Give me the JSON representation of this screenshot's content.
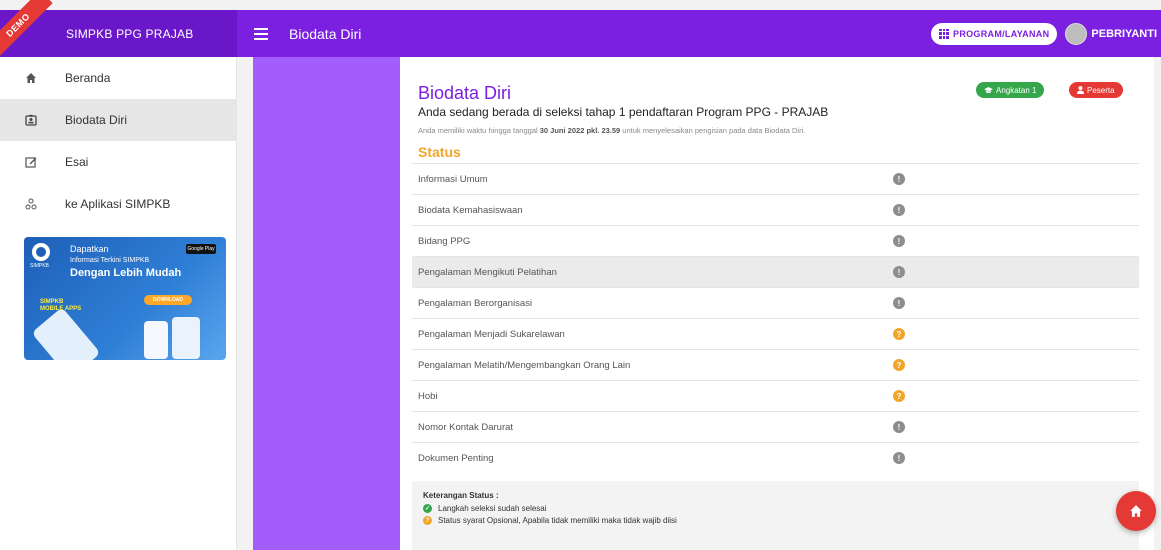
{
  "brand": {
    "ribbon": "DEMO",
    "title": "SIMPKB PPG PRAJAB"
  },
  "header": {
    "title": "Biodata Diri",
    "program_button": "PROGRAM/LAYANAN",
    "user_name": "PEBRIYANTI"
  },
  "sidebar": {
    "items": [
      {
        "label": "Beranda",
        "icon": "home-icon"
      },
      {
        "label": "Biodata Diri",
        "icon": "id-badge-icon",
        "active": true
      },
      {
        "label": "Esai",
        "icon": "edit-icon"
      },
      {
        "label": "ke Aplikasi SIMPKB",
        "icon": "apps-icon"
      }
    ],
    "banner": {
      "heading": "Dapatkan",
      "line1": "Informasi Terkini SIMPKB",
      "line2": "Dengan Lebih Mudah",
      "download": "DOWNLOAD",
      "app_label": "SIMPKB MOBILE APPS",
      "logo_text": "SIMPKB",
      "store": "Google Play"
    }
  },
  "main": {
    "title": "Biodata Diri",
    "badges": {
      "angkatan": "Angkatan 1",
      "peserta": "Peserta"
    },
    "subtitle": "Anda sedang berada di seleksi tahap 1 pendaftaran Program PPG - PRAJAB",
    "note_prefix": "Anda memiliki waktu hingga tanggal ",
    "note_deadline": "30 Juni 2022 pkl. 23.59",
    "note_suffix": " untuk menyelesaikan pengisian pada data Biodata Diri.",
    "status_heading": "Status",
    "status_rows": [
      {
        "label": "Informasi Umum",
        "status": "grey",
        "symbol": "!"
      },
      {
        "label": "Biodata Kemahasiswaan",
        "status": "grey",
        "symbol": "!"
      },
      {
        "label": "Bidang PPG",
        "status": "grey",
        "symbol": "!"
      },
      {
        "label": "Pengalaman Mengikuti Pelatihan",
        "status": "grey",
        "symbol": "!",
        "highlighted": true
      },
      {
        "label": "Pengalaman Berorganisasi",
        "status": "grey",
        "symbol": "!"
      },
      {
        "label": "Pengalaman Menjadi Sukarelawan",
        "status": "yellow",
        "symbol": "?"
      },
      {
        "label": "Pengalaman Melatih/Mengembangkan Orang Lain",
        "status": "yellow",
        "symbol": "?"
      },
      {
        "label": "Hobi",
        "status": "yellow",
        "symbol": "?"
      },
      {
        "label": "Nomor Kontak Darurat",
        "status": "grey",
        "symbol": "!"
      },
      {
        "label": "Dokumen Penting",
        "status": "grey",
        "symbol": "!"
      }
    ],
    "legend": {
      "title": "Keterangan Status :",
      "items": [
        {
          "text": "Langkah seleksi sudah selesai",
          "color": "green"
        },
        {
          "text": "Status syarat Opsional, Apabila tidak memiliki maka tidak wajib diisi",
          "color": "yellow"
        }
      ]
    }
  },
  "colors": {
    "primary": "#7b1fe0",
    "accent_column": "#a45dfd",
    "warning": "#f3a52b",
    "danger": "#e53935",
    "success": "#35a64a"
  }
}
